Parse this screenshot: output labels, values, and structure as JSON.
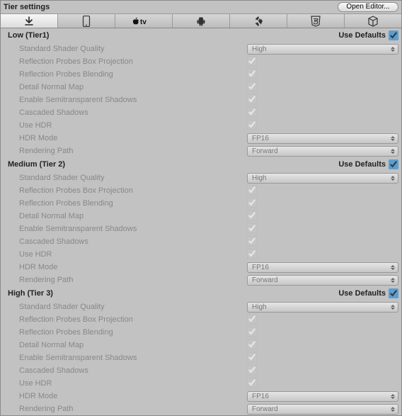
{
  "header": {
    "title": "Tier settings",
    "openEditor": "Open Editor..."
  },
  "tabs": {
    "selectedIndex": 0,
    "items": [
      "download",
      "mobile",
      "apple-tv",
      "android",
      "unity",
      "html5",
      "cube"
    ]
  },
  "useDefaultsLabel": "Use Defaults",
  "tiers": [
    {
      "name": "Low (Tier1)",
      "useDefaults": true,
      "settings": [
        {
          "label": "Standard Shader Quality",
          "type": "dropdown",
          "value": "High"
        },
        {
          "label": "Reflection Probes Box Projection",
          "type": "checkbox",
          "value": true
        },
        {
          "label": "Reflection Probes Blending",
          "type": "checkbox",
          "value": true
        },
        {
          "label": "Detail Normal Map",
          "type": "checkbox",
          "value": true
        },
        {
          "label": "Enable Semitransparent Shadows",
          "type": "checkbox",
          "value": true
        },
        {
          "label": "Cascaded Shadows",
          "type": "checkbox",
          "value": true
        },
        {
          "label": "Use HDR",
          "type": "checkbox",
          "value": true
        },
        {
          "label": "HDR Mode",
          "type": "dropdown",
          "value": "FP16"
        },
        {
          "label": "Rendering Path",
          "type": "dropdown",
          "value": "Forward"
        }
      ]
    },
    {
      "name": "Medium (Tier 2)",
      "useDefaults": true,
      "settings": [
        {
          "label": "Standard Shader Quality",
          "type": "dropdown",
          "value": "High"
        },
        {
          "label": "Reflection Probes Box Projection",
          "type": "checkbox",
          "value": true
        },
        {
          "label": "Reflection Probes Blending",
          "type": "checkbox",
          "value": true
        },
        {
          "label": "Detail Normal Map",
          "type": "checkbox",
          "value": true
        },
        {
          "label": "Enable Semitransparent Shadows",
          "type": "checkbox",
          "value": true
        },
        {
          "label": "Cascaded Shadows",
          "type": "checkbox",
          "value": true
        },
        {
          "label": "Use HDR",
          "type": "checkbox",
          "value": true
        },
        {
          "label": "HDR Mode",
          "type": "dropdown",
          "value": "FP16"
        },
        {
          "label": "Rendering Path",
          "type": "dropdown",
          "value": "Forward"
        }
      ]
    },
    {
      "name": "High (Tier 3)",
      "useDefaults": true,
      "settings": [
        {
          "label": "Standard Shader Quality",
          "type": "dropdown",
          "value": "High"
        },
        {
          "label": "Reflection Probes Box Projection",
          "type": "checkbox",
          "value": true
        },
        {
          "label": "Reflection Probes Blending",
          "type": "checkbox",
          "value": true
        },
        {
          "label": "Detail Normal Map",
          "type": "checkbox",
          "value": true
        },
        {
          "label": "Enable Semitransparent Shadows",
          "type": "checkbox",
          "value": true
        },
        {
          "label": "Cascaded Shadows",
          "type": "checkbox",
          "value": true
        },
        {
          "label": "Use HDR",
          "type": "checkbox",
          "value": true
        },
        {
          "label": "HDR Mode",
          "type": "dropdown",
          "value": "FP16"
        },
        {
          "label": "Rendering Path",
          "type": "dropdown",
          "value": "Forward"
        }
      ]
    }
  ]
}
